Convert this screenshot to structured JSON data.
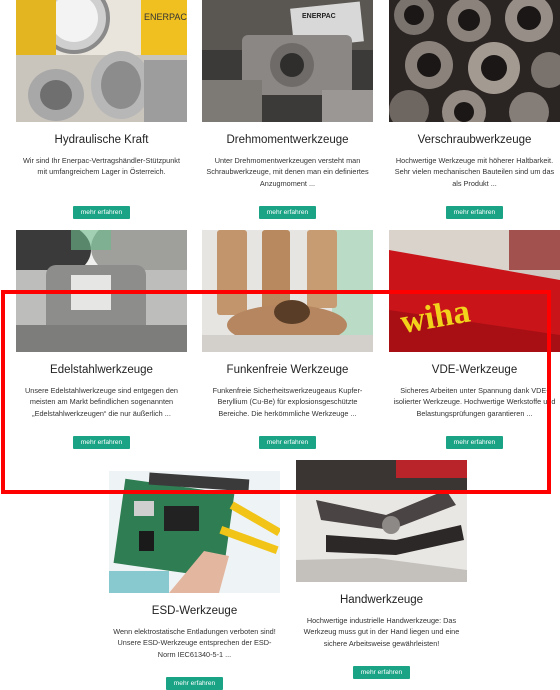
{
  "cards": [
    {
      "title": "Hydraulische Kraft",
      "text": "Wir sind Ihr Enerpac-Vertragshändler-Stützpunkt mit umfangreichem Lager in Österreich.",
      "button": "mehr erfahren",
      "image_text": "ENERPAC"
    },
    {
      "title": "Drehmomentwerkzeuge",
      "text": "Unter Drehmomentwerkzeugen versteht man Schraubwerkzeuge, mit denen man ein definiertes Anzugmoment ...",
      "button": "mehr erfahren",
      "image_text": "ENERPAC"
    },
    {
      "title": "Verschraubwerkzeuge",
      "text": "Hochwertige Werkzeuge mit höherer Haltbarkeit. Sehr vielen mechanischen Bauteilen sind um das als Produkt ...",
      "button": "mehr erfahren"
    },
    {
      "title": "Edelstahlwerkzeuge",
      "text": "Unsere Edelstahlwerkzeuge sind entgegen den meisten am Markt befindlichen sogenannten „Edelstahlwerkzeugen“ die nur äußerlich ...",
      "button": "mehr erfahren"
    },
    {
      "title": "Funkenfreie Werkzeuge",
      "text": "Funkenfreie Sicherheitswerkzeugeaus Kupfer-Beryllium (Cu-Be) für explosionsgeschützte Bereiche. Die herkömmliche Werkzeuge ...",
      "button": "mehr erfahren"
    },
    {
      "title": "VDE-Werkzeuge",
      "text": "Sicheres Arbeiten unter Spannung dank VDE-isolierter Werkzeuge. Hochwertige Werkstoffe und Belastungsprüfungen garantieren ...",
      "button": "mehr erfahren",
      "image_text": "wiha"
    },
    {
      "title": "ESD-Werkzeuge",
      "text": "Wenn elektrostatische Entladungen verboten sind! Unsere ESD-Werkzeuge entsprechen der ESD-Norm IEC61340-5-1 ...",
      "button": "mehr erfahren"
    },
    {
      "title": "Handwerkzeuge",
      "text": "Hochwertige industrielle Handwerkzeuge: Das Werkzeug muss gut in der Hand liegen und eine sichere Arbeitsweise gewährleisten!",
      "button": "mehr erfahren"
    }
  ]
}
